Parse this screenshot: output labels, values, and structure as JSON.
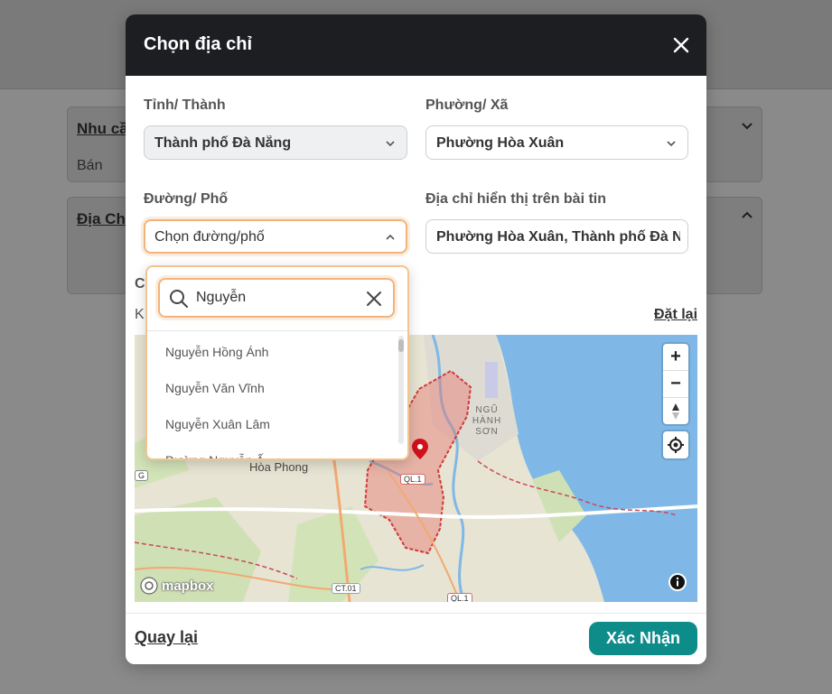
{
  "background": {
    "card1": {
      "title": "Nhu cầ",
      "subtitle": "Bán"
    },
    "card2": {
      "title": "Địa Ch"
    }
  },
  "modal": {
    "title": "Chọn địa chỉ",
    "province": {
      "label": "Tỉnh/ Thành",
      "value": "Thành phố Đà Nẵng"
    },
    "ward": {
      "label": "Phường/ Xã",
      "value": "Phường Hòa Xuân"
    },
    "street": {
      "label": "Đường/ Phố",
      "placeholder": "Chọn đường/phố"
    },
    "display_address": {
      "label": "Địa chỉ hiển thị trên bài tin",
      "value": "Phường Hòa Xuân, Thành phố Đà Nẵ"
    },
    "street_dropdown": {
      "search_value": "Nguyễn",
      "items": [
        "Nguyễn Hồng Ánh",
        "Nguyễn Văn Vĩnh",
        "Nguyễn Xuân Lâm",
        "Đường Nguyễn Ấ"
      ]
    },
    "hidden_labels": {
      "coords_label": "C",
      "coords_sub": "K"
    },
    "reset_label": "Đặt lại",
    "map": {
      "labels": {
        "area": "NGŨ HÀNH SƠN",
        "place": "Hòa Phong",
        "road1": "QL.1",
        "road2": "CT.01",
        "road3": "QL.1",
        "road4": "G"
      },
      "attribution": "mapbox",
      "zoom_in": "+",
      "zoom_out": "−"
    },
    "back_label": "Quay lại",
    "confirm_label": "Xác Nhận"
  },
  "colors": {
    "header": "#1c1e21",
    "accent": "#0e8c8a",
    "focus": "#f2b37a",
    "sea": "#7fb8e6",
    "land": "#e9e5d6"
  }
}
